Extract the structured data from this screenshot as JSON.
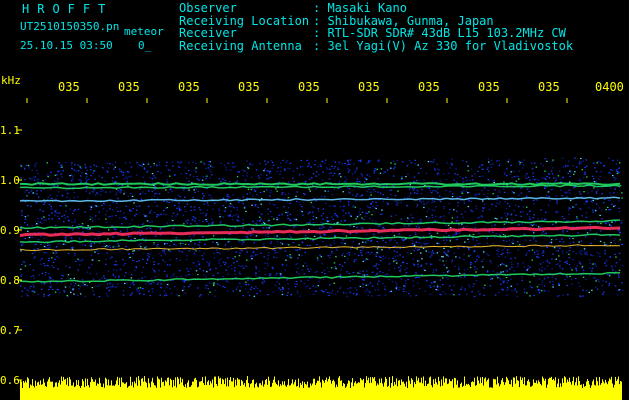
{
  "header": {
    "title": "HROFFT",
    "filename": "UT2510150350.pn",
    "type": "meteor",
    "date": "25.10.15 03:50",
    "seconds": "0_"
  },
  "meta": [
    {
      "key": "Observer",
      "value": ": Masaki Kano"
    },
    {
      "key": "Receiving Location",
      "value": ": Shibukawa, Gunma, Japan"
    },
    {
      "key": "Receiver",
      "value": ": RTL-SDR SDR# 43dB L15 103.2MHz CW"
    },
    {
      "key": "Receiving Antenna",
      "value": ": 3el Yagi(V) Az 330 for Vladivostok"
    }
  ],
  "axis": {
    "unit": "kHz",
    "y_ticks": [
      "1.1",
      "1.0",
      "0.9",
      "0.8",
      "0.7",
      "0.6"
    ],
    "x_ticks": [
      "035",
      "035",
      "035",
      "035",
      "035",
      "035",
      "035",
      "035",
      "035",
      "0400"
    ]
  },
  "colors": {
    "text": "#00e6e6",
    "axis": "#ffff00",
    "background": "#000000",
    "noise": "#1a3cff",
    "strong": "#ff3060",
    "mid": "#22dd66"
  }
}
